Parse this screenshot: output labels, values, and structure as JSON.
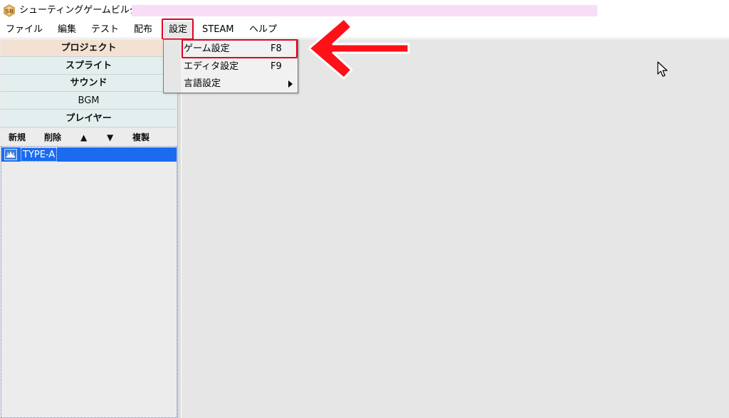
{
  "window": {
    "title": "シューティングゲームビルダー"
  },
  "menubar": {
    "items": [
      {
        "label": "ファイル"
      },
      {
        "label": "編集"
      },
      {
        "label": "テスト"
      },
      {
        "label": "配布"
      },
      {
        "label": "設定"
      },
      {
        "label": "STEAM"
      },
      {
        "label": "ヘルプ"
      }
    ],
    "active_index": 4
  },
  "settings_menu": {
    "items": [
      {
        "label": "ゲーム設定",
        "shortcut": "F8",
        "highlighted": true
      },
      {
        "label": "エディタ設定",
        "shortcut": "F9"
      },
      {
        "label": "言語設定",
        "submenu": true
      }
    ]
  },
  "sidebar": {
    "categories": [
      {
        "label": "プロジェクト",
        "selected": true
      },
      {
        "label": "スプライト"
      },
      {
        "label": "サウンド"
      },
      {
        "label": "BGM"
      },
      {
        "label": "プレイヤー"
      }
    ],
    "toolbar": {
      "new_label": "新規",
      "delete_label": "削除",
      "up_label": "▲",
      "down_label": "▼",
      "copy_label": "複製"
    },
    "list": [
      {
        "label": "TYPE-A",
        "icon": "ship-icon",
        "selected": true
      }
    ]
  },
  "colors": {
    "highlight": "#e00020",
    "selection": "#1a6bf0",
    "category_selected": "#f3e2d3",
    "category": "#e3efef",
    "title_redaction": "#f8ddf7"
  }
}
